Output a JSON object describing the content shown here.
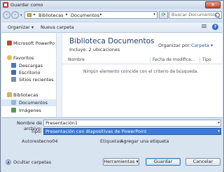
{
  "window": {
    "title": "Guardar como",
    "close_glyph": "✕"
  },
  "address": {
    "path": [
      "Bibliotecas",
      "Documentos"
    ],
    "search_placeholder": "Buscar Documentos"
  },
  "toolbar": {
    "organize": "Organizar",
    "new_folder": "Nueva carpeta",
    "help_glyph": "?"
  },
  "nav": {
    "items": [
      {
        "label": "Microsoft PowerPo",
        "icon": "powerpoint-icon",
        "color": "#c9452a",
        "indent": false,
        "selected": false
      },
      {
        "label": "Favoritos",
        "icon": "star-icon",
        "color": "#e8b84a",
        "indent": false,
        "selected": false
      },
      {
        "label": "Descargas",
        "icon": "downloads-icon",
        "color": "#4a78b8",
        "indent": true,
        "selected": false
      },
      {
        "label": "Escritorio",
        "icon": "desktop-icon",
        "color": "#3f6fae",
        "indent": true,
        "selected": false
      },
      {
        "label": "Sitios recientes",
        "icon": "recent-places-icon",
        "color": "#7a8fa8",
        "indent": true,
        "selected": false
      },
      {
        "label": "Bibliotecas",
        "icon": "libraries-icon",
        "color": "#d7b45a",
        "indent": false,
        "selected": false
      },
      {
        "label": "Documentos",
        "icon": "documents-icon",
        "color": "#9db4cf",
        "indent": true,
        "selected": true
      },
      {
        "label": "Imágenes",
        "icon": "pictures-icon",
        "color": "#5b9a4a",
        "indent": true,
        "selected": false
      }
    ]
  },
  "content": {
    "title": "Biblioteca Documentos",
    "subtitle": "Incluye: 2 ubicaciones",
    "arrange_label": "Organizar por:",
    "arrange_value": "Carpeta",
    "columns": [
      "Nombre",
      "Fecha de modifica...",
      "Tipo"
    ],
    "empty_message": "Ningún elemento coincide con el criterio de búsqueda."
  },
  "form": {
    "filename_label": "Nombre de archivo:",
    "filename_value": "Presentación1",
    "type_label": "Tipo:",
    "type_value": "Presentación con diapositivas de PowerPoint",
    "authors_label": "Autores:",
    "authors_value": "tecno04",
    "tags_label": "Etiquetas:",
    "tags_value": "Agregar una etiqueta"
  },
  "footer": {
    "hide_folders": "Ocultar carpetas",
    "tools": "Herramientas",
    "save": "Guardar",
    "cancel": "Cancelar"
  },
  "colors": {
    "selection": "#3b78d8",
    "accent_link": "#1f56a6",
    "title_blue": "#1e3c6e"
  }
}
